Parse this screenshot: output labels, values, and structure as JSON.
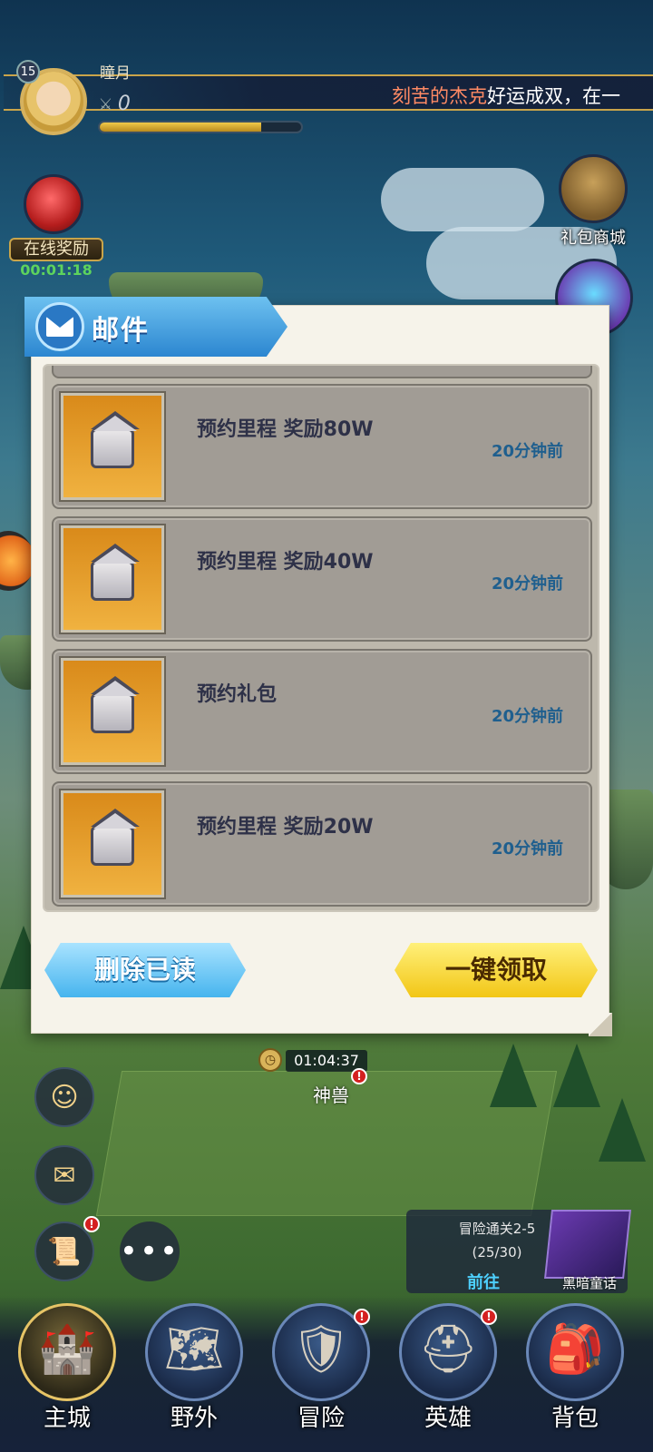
{
  "hud": {
    "level": "15",
    "player_name": "瞳月",
    "power": "0",
    "exp_fraction": 0.8,
    "marquee_highlight": "刻苦的杰克",
    "marquee_rest": "好运成双，在一"
  },
  "side_left": {
    "online_reward_label": "在线奖励",
    "online_reward_timer": "00:01:18"
  },
  "side_right": {
    "gift_shop_label": "礼包商城"
  },
  "mail_modal": {
    "title": "邮件",
    "items": [
      {
        "title": "预约里程 奖励80W",
        "time": "20分钟前"
      },
      {
        "title": "预约里程 奖励40W",
        "time": "20分钟前"
      },
      {
        "title": "预约礼包",
        "time": "20分钟前"
      },
      {
        "title": "预约里程 奖励20W",
        "time": "20分钟前"
      }
    ],
    "delete_read_label": "删除已读",
    "claim_all_label": "一键领取"
  },
  "beast": {
    "timer": "01:04:37",
    "label": "神兽"
  },
  "quest": {
    "title": "冒险通关2-5",
    "progress": "(25/30)",
    "go_label": "前往",
    "book_label": "黑暗童话"
  },
  "bottom_nav": [
    {
      "label": "主城"
    },
    {
      "label": "野外"
    },
    {
      "label": "冒险"
    },
    {
      "label": "英雄"
    },
    {
      "label": "背包"
    }
  ],
  "colors": {
    "modal_bg": "#f6f3ea",
    "mail_item_bg": "#a19c95",
    "mail_time": "#1f5f8e",
    "delete_button": "#46b4ee",
    "claim_button": "#f2c616",
    "marquee_highlight": "#ff8a64"
  }
}
